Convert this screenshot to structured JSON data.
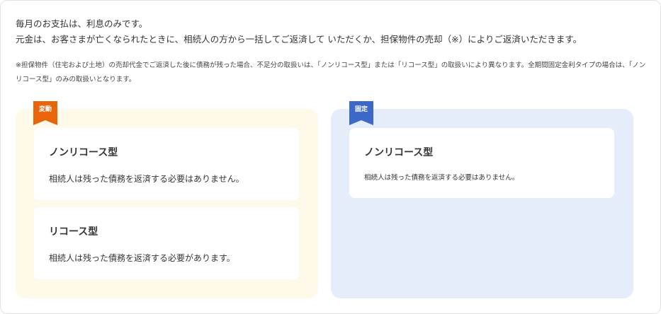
{
  "intro": {
    "line1": "毎月のお支払は、利息のみです。",
    "line2": "元金は、お客さまが亡くなられたときに、相続人の方から一括してご返済して いただくか、担保物件の売却（※）によりご返済いただきます。"
  },
  "note": "※担保物件（住宅および土地）の売却代金でご返済した後に債務が残った場合、不足分の取扱いは、「ノンリコース型」または「リコース型」の取扱いにより異なります。全期間固定金利タイプの場合は、「ノンリコース型」のみの取扱いとなります。",
  "variable": {
    "ribbon_label": "変動",
    "ribbon_color": "#e8650a",
    "panel_color": "#fff9ea",
    "cards": [
      {
        "title": "ノンリコース型",
        "text": "相続人は残った債務を返済する必要はありません。"
      },
      {
        "title": "リコース型",
        "text": "相続人は残った債務を返済する必要があります。"
      }
    ]
  },
  "fixed": {
    "ribbon_label": "固定",
    "ribbon_color": "#3c68c8",
    "panel_color": "#e6edfa",
    "cards": [
      {
        "title": "ノンリコース型",
        "text": "相続人は残った債務を返済する必要はありません。"
      }
    ]
  }
}
